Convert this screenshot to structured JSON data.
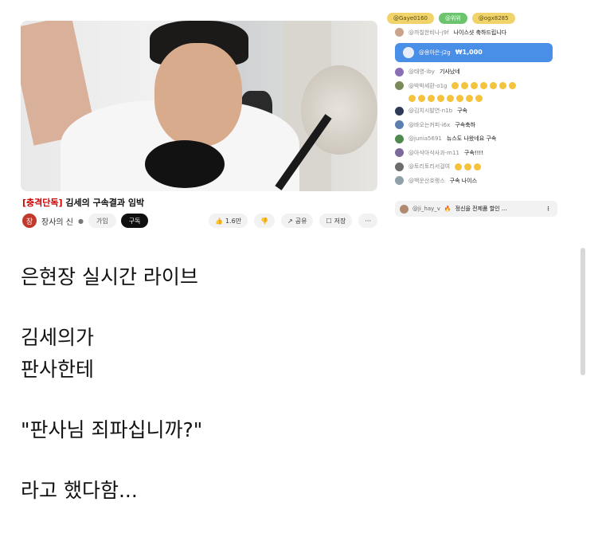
{
  "video": {
    "title_prefix": "[충격단독]",
    "title_rest": " 김세의 구속결과 임박",
    "channel_name": "장사의 신",
    "channel_initial": "장",
    "join_label": "가입",
    "subscribe_label": "구독",
    "like_count": "1.6만",
    "share_label": "공유",
    "save_label": "저장",
    "more_label": "···"
  },
  "chat": {
    "top_chips": [
      "@Gaye0160",
      "@위위",
      "@ogx8285"
    ],
    "messages": [
      {
        "name": "@까칠한비나-j9f",
        "text": "나이스샷 축하드립니다"
      }
    ],
    "superchat": {
      "name": "@용아은-j2g",
      "amount": "₩1,000"
    },
    "messages2": [
      {
        "name": "@태영-iby",
        "text": "기사났네"
      },
      {
        "name": "@박박세환-o1g",
        "text": ""
      },
      {
        "name": "@김치시발연-n1b",
        "text": "구속"
      },
      {
        "name": "@바오는커피-i6x",
        "text": "구속축하"
      },
      {
        "name": "@junia5691",
        "text": "뉴스도 나왔네요 구속"
      },
      {
        "name": "@아삭아삭사과-m11",
        "text": "구속!!!!"
      },
      {
        "name": "@토리토리서걸여",
        "text": ""
      },
      {
        "name": "@백운산호랭스",
        "text": "구속 나이스"
      }
    ],
    "pinned": {
      "name": "@ji_hay_v",
      "text": "정신을 전제품 할인 ..."
    },
    "more_icon": "⋮"
  },
  "caption": {
    "line1": "은현장 실시간 라이브",
    "line2": "김세의가",
    "line3": "판사한테",
    "line4": "\"판사님 죄파십니까?\"",
    "line5": "라고 했다함..."
  },
  "colors": {
    "superchat": "#4a8fe7",
    "chip_gold": "#f1d36b",
    "title_red": "#cc0000"
  }
}
